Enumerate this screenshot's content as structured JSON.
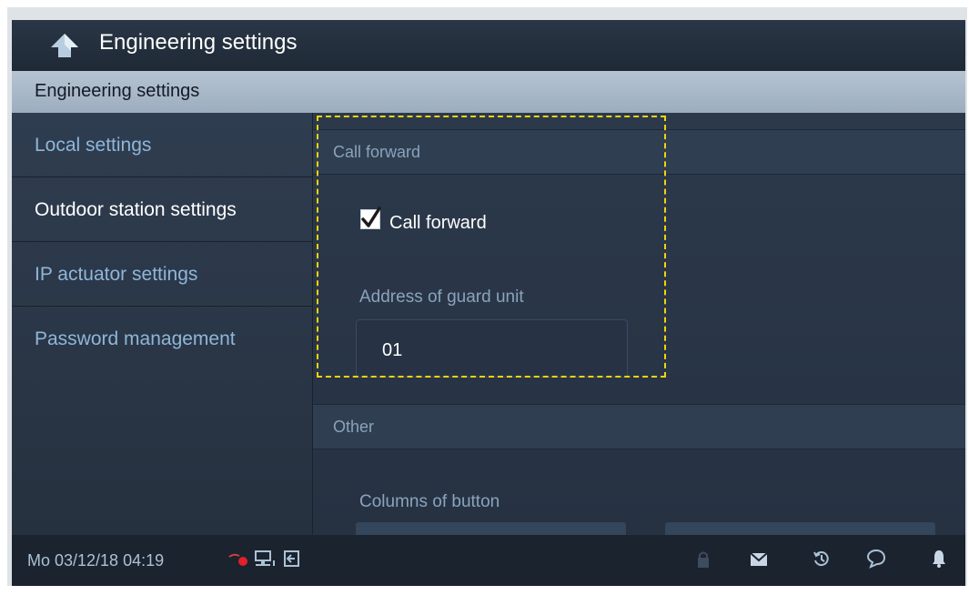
{
  "header": {
    "title": "Engineering settings",
    "back_icon": "back-arrow-icon"
  },
  "section": {
    "title": "Engineering settings"
  },
  "sidebar": {
    "items": [
      {
        "label": "Local settings",
        "active": false
      },
      {
        "label": "Outdoor station settings",
        "active": true
      },
      {
        "label": "IP actuator settings",
        "active": false
      },
      {
        "label": "Password management",
        "active": false
      }
    ]
  },
  "call_forward": {
    "group_title": "Call forward",
    "checkbox_label": "Call forward",
    "checked": true,
    "address_label": "Address of guard unit",
    "address_value": "01"
  },
  "other": {
    "group_title": "Other",
    "columns_label": "Columns of button"
  },
  "status_bar": {
    "datetime": "Mo 03/12/18  04:19",
    "left_icons": [
      "mute-indicator-icon",
      "network-icon",
      "exit-icon"
    ],
    "right_icons": [
      "lock-icon",
      "mail-icon",
      "history-icon",
      "message-icon",
      "bell-icon"
    ]
  },
  "colors": {
    "accent_text": "#8fb6d8",
    "header_bar": "#a9b9ca",
    "highlight_dash": "#f2d40c",
    "mute_red": "#e0202a"
  }
}
